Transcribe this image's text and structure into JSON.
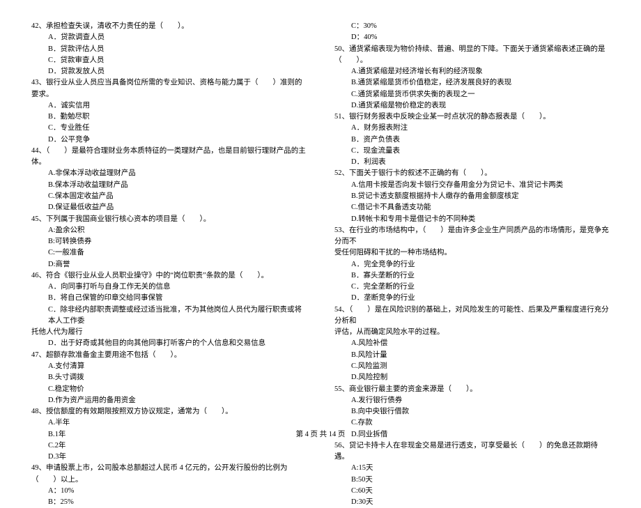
{
  "left": {
    "q42": {
      "stem": "42、承担检查失误，清收不力责任的是（　　）。",
      "opts": [
        "A．贷款调查人员",
        "B．贷款评估人员",
        "C．贷款审查人员",
        "D．贷款发放人员"
      ]
    },
    "q43": {
      "stem": "43、银行业从业人员应当具备岗位所需的专业知识、资格与能力属于（　　）准则的要求。",
      "opts": [
        "A．诚实信用",
        "B．勤勉尽职",
        "C．专业胜任",
        "D．公平竞争"
      ]
    },
    "q44": {
      "stem": "44、（　　）是最符合理财业务本质特征的一类理财产品，也是目前银行理财产品的主体。",
      "opts": [
        "A.非保本浮动收益理财产品",
        "B.保本浮动收益理财产品",
        "C.保本固定收益产品",
        "D.保证最低收益产品"
      ]
    },
    "q45": {
      "stem": "45、下列属于我国商业银行核心资本的项目是（　　）。",
      "opts": [
        "A:盈余公积",
        "B:可转换债券",
        "C:一般准备",
        "D:商誉"
      ]
    },
    "q46": {
      "stem": "46、符合《银行业从业人员职业操守》中的“岗位职责”条款的是（　　）。",
      "opts": [
        "A．向同事打听与自身工作无关的信息",
        "B．将自己保管的印章交给同事保管",
        "C．除非经内部职责调整或经过适当批准，不为其他岗位人员代为履行职责或将本人工作委",
        "托他人代为履行",
        "D．出于好奇或其他目的向其他同事打听客户的个人信息和交易信息"
      ]
    },
    "q47": {
      "stem": "47、超额存款准备金主要用途不包括（　　）。",
      "opts": [
        "A.支付清算",
        "B.头寸调拨",
        "C.稳定物价",
        "D.作为资产运用的备用资金"
      ]
    },
    "q48": {
      "stem": "48、授信额度的有效期限按照双方协议规定，通常为（　　）。",
      "opts": [
        "A.半年",
        "B.1年",
        "C.2年",
        "D.3年"
      ]
    },
    "q49": {
      "stem": "49、申请股票上市，公司股本总额超过人民币 4 亿元的，公开发行股份的比例为（　　）以上。",
      "opts": [
        "A：10%",
        "B：25%"
      ]
    }
  },
  "right": {
    "q49c": {
      "opts": [
        "C：30%",
        "D：40%"
      ]
    },
    "q50": {
      "stem": "50、通货紧缩表现为物价持续、普遍、明显的下降。下面关于通货紧缩表述正确的是（　　）。",
      "opts": [
        "A.通货紧缩是对经济增长有利的经济现象",
        "B.通货紧缩是货币价值稳定，经济发展良好的表现",
        "C.通货紧缩是货币供求失衡的表现之一",
        "D.通货紧缩是物价稳定的表现"
      ]
    },
    "q51": {
      "stem": "51、银行财务报表中反映企业某一时点状况的静态报表是（　　）。",
      "opts": [
        "A．财务报表附注",
        "B．资产负债表",
        "C．现金流量表",
        "D．利润表"
      ]
    },
    "q52": {
      "stem": "52、下面关于银行卡的叙述不正确的有（　　）。",
      "opts": [
        "A.信用卡按是否向发卡银行交存备用金分为贷记卡、准贷记卡两类",
        "B.贷记卡透支额度根据持卡人缴存的备用金额度核定",
        "C.借记卡不具备透支功能",
        "D.转帐卡和专用卡是借记卡的不同种类"
      ]
    },
    "q53": {
      "stemPart1": "53、在行业的市场结构中，（　　）是由许多企业生产同质产品的市场情形，是竞争充分而不",
      "stemPart2": "受任何阻碍和干扰的一种市场结构。",
      "opts": [
        "A．完全竞争的行业",
        "B．寡头垄断的行业",
        "C．完全垄断的行业",
        "D．垄断竞争的行业"
      ]
    },
    "q54": {
      "stemPart1": "54、（　　）是在风险识别的基础上，对风险发生的可能性、后果及严重程度进行充分分析和",
      "stemPart2": "评估，从而确定风险水平的过程。",
      "opts": [
        "A.风险补偿",
        "B.风险计量",
        "C.风险监测",
        "D.风险控制"
      ]
    },
    "q55": {
      "stem": "55、商业银行最主要的资金来源是（　　）。",
      "opts": [
        "A.发行银行债券",
        "B.向中央银行借款",
        "C.存款",
        "D.同业拆借"
      ]
    },
    "q56": {
      "stem": "56、贷记卡持卡人在非现金交易是进行透支，可享受最长（　　）的免息还款期待遇。",
      "opts": [
        "A:15天",
        "B:50天",
        "C:60天",
        "D:30天"
      ]
    }
  },
  "footer": "第 4 页 共 14 页"
}
